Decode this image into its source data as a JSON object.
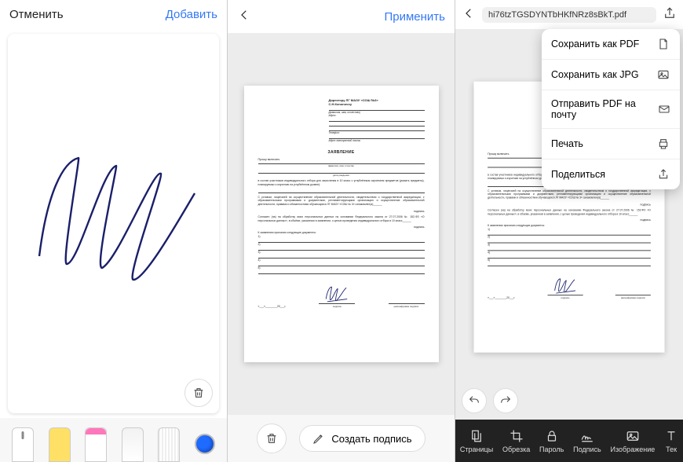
{
  "panel1": {
    "cancel": "Отменить",
    "add": "Добавить"
  },
  "panel2": {
    "apply": "Применить",
    "create_sig": "Создать подпись"
  },
  "panel3": {
    "filename": "hi76tzTGSDYNTbHKfNRz8sBkT.pdf",
    "menu": {
      "save_pdf": "Сохранить как PDF",
      "save_jpg": "Сохранить как JPG",
      "send_pdf": "Отправить PDF на почту",
      "print": "Печать",
      "share": "Поделиться"
    },
    "tabs": {
      "pages": "Страницы",
      "crop": "Обрезка",
      "password": "Пароль",
      "sign": "Подпись",
      "image": "Изображение",
      "text": "Тек"
    }
  },
  "doc": {
    "to1": "Директору ЛГ МАОУ «СОШ №3»",
    "to2": "С.Н.Кononovoy",
    "fio_cap": "(фамилия, имя, отчество)",
    "addr_label": "Адрес:",
    "tel_label": "Телефон:",
    "email_label": "Адрес электронной почты",
    "title": "ЗАЯВЛЕНИЕ",
    "ask": "Прошу включить",
    "fio_row_cap": "фамилия, имя отчество",
    "dob_cap": "дата рождения",
    "para1": "в состав участников индивидуального отбора для зачисления в 10 класс с углублённым изучением предметов (указать предметы), планируемых к изучению на углублённом уровне):",
    "para2": "С уставом, лицензией на осуществление образовательной деятельности, свидетельством о государственной аккредитации, с образовательными программами и документами, регламентирующими организацию и осуществление образовательной деятельности, правами и обязанностями обучающихся ЛГ МАОУ «СОШ № 3» ознакомлен(а)______",
    "podpis_lbl": "подпись",
    "para3": "Согласен (на) на обработку моих персональных данных на основании Федерального закона от 27.07.2006 № 152-ФЗ «О персональных данных», в объёме, указанном в заявлении, с целью проведения индивидуального отбора в 10 класс______",
    "attach": "К заявлению прилагаю следующие документы:",
    "li1": "1)",
    "li2": "2)",
    "li3": "3)",
    "li4": "4)",
    "li5": "5)",
    "date_fmt": "«___»________20___г.",
    "sig_cap1": "подпись",
    "sig_cap2": "расшифровка подписи"
  }
}
